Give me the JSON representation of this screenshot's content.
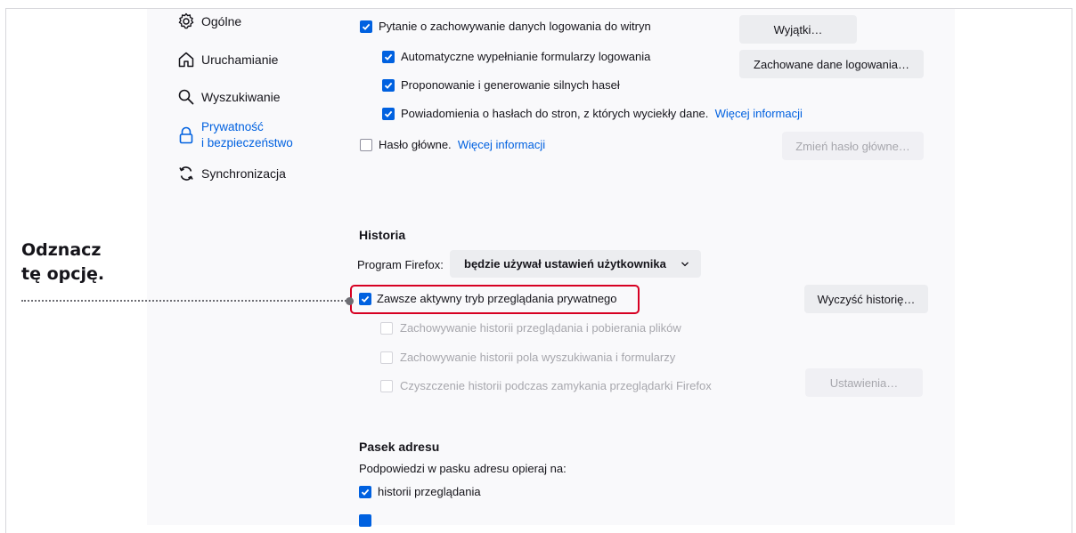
{
  "sidebar": {
    "general": "Ogólne",
    "home": "Uruchamianie",
    "search": "Wyszukiwanie",
    "privacy_line1": "Prywatność",
    "privacy_line2": "i bezpieczeństwo",
    "sync": "Synchronizacja"
  },
  "logins": {
    "ask_save": "Pytanie o zachowywanie danych logowania do witryn",
    "autofill": "Automatyczne wypełnianie formularzy logowania",
    "suggest": "Proponowanie i generowanie silnych haseł",
    "alerts": "Powiadomienia o hasłach do stron, z których wyciekły dane.",
    "alerts_link": "Więcej informacji",
    "primary": "Hasło główne.",
    "primary_link": "Więcej informacji",
    "exceptions_btn": "Wyjątki…",
    "saved_btn": "Zachowane dane logowania…",
    "change_primary_btn": "Zmień hasło główne…"
  },
  "history": {
    "heading": "Historia",
    "program_label": "Program Firefox:",
    "mode_select": "będzie używał ustawień użytkownika",
    "private_always": "Zawsze aktywny tryb przeglądania prywatnego",
    "clear_btn": "Wyczyść historię…",
    "remember_browsing": "Zachowywanie historii przeglądania i pobierania plików",
    "remember_search": "Zachowywanie historii pola wyszukiwania i formularzy",
    "clear_on_close": "Czyszczenie historii podczas zamykania przeglądarki Firefox",
    "settings_btn": "Ustawienia…"
  },
  "address_bar": {
    "heading": "Pasek adresu",
    "desc": "Podpowiedzi w pasku adresu opieraj na:",
    "browsing_history": "historii przeglądania"
  },
  "callout": {
    "line1": "Odznacz",
    "line2": "tę opcję."
  },
  "colors": {
    "accent": "#0061e0",
    "highlight_border": "#d70022"
  }
}
